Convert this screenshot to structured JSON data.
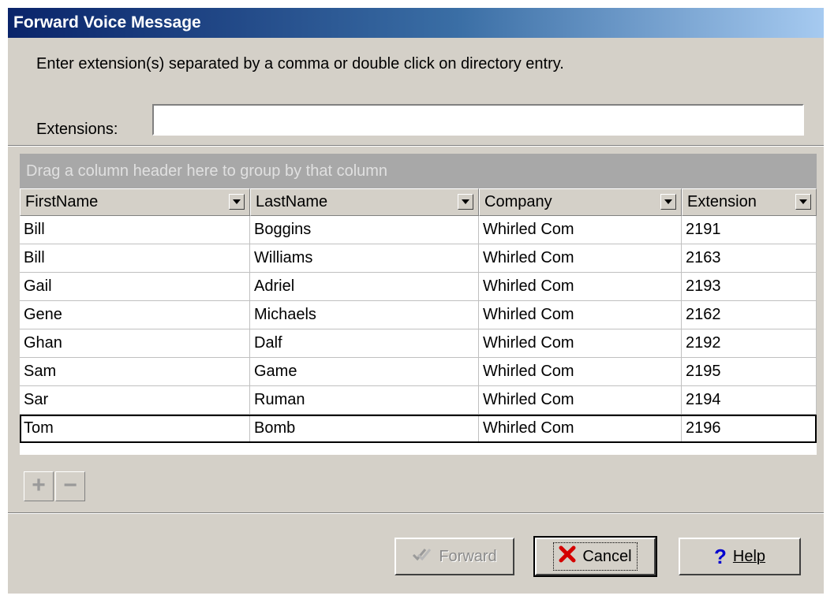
{
  "window": {
    "title": "Forward Voice Message"
  },
  "instructions": "Enter extension(s) separated by a comma or double click on directory entry.",
  "extensions": {
    "label": "Extensions:",
    "value": "",
    "placeholder": ""
  },
  "grid": {
    "group_hint": "Drag a column header here to group by that column",
    "columns": [
      "FirstName",
      "LastName",
      "Company",
      "Extension"
    ],
    "rows": [
      [
        "Bill",
        "Boggins",
        "Whirled Com",
        "2191"
      ],
      [
        "Bill",
        "Williams",
        "Whirled Com",
        "2163"
      ],
      [
        "Gail",
        "Adriel",
        "Whirled Com",
        "2193"
      ],
      [
        "Gene",
        "Michaels",
        "Whirled Com",
        "2162"
      ],
      [
        "Ghan",
        "Dalf",
        "Whirled Com",
        "2192"
      ],
      [
        "Sam",
        "Game",
        "Whirled Com",
        "2195"
      ],
      [
        "Sar",
        "Ruman",
        "Whirled Com",
        "2194"
      ],
      [
        "Tom",
        "Bomb",
        "Whirled Com",
        "2196"
      ]
    ],
    "selected_row": 7
  },
  "navigator": {
    "add": "+",
    "remove": "−"
  },
  "buttons": {
    "forward": {
      "label": "Forward",
      "enabled": false,
      "icon": "check-marks-icon"
    },
    "cancel": {
      "label": "Cancel",
      "icon": "red-x-icon"
    },
    "help": {
      "label": "Help",
      "icon": "question-mark-icon"
    }
  },
  "colors": {
    "title_gradient_start": "#0a246a",
    "dialog_bg": "#d4d0c8",
    "group_panel": "#a8a8a8",
    "cancel_icon": "#d40000",
    "help_icon": "#0000d0"
  }
}
